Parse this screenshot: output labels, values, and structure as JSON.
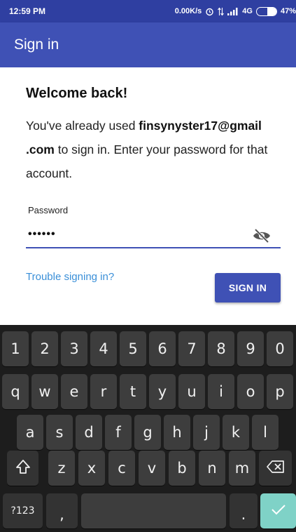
{
  "status_bar": {
    "time": "12:59 PM",
    "network_speed": "0.00K/s",
    "network_type": "4G",
    "battery_percent": "47%",
    "battery_level": 0.47
  },
  "app_bar": {
    "title": "Sign in"
  },
  "content": {
    "title": "Welcome back!",
    "message_prefix": "You've already used ",
    "email_part1": "finsynyster17@gmail",
    "email_part2": ".com",
    "message_suffix": " to sign in. Enter your password for that account.",
    "password_label": "Password",
    "password_value": "••••••",
    "trouble_link": "Trouble signing in?",
    "signin_button": "SIGN IN"
  },
  "keyboard": {
    "row1": [
      "1",
      "2",
      "3",
      "4",
      "5",
      "6",
      "7",
      "8",
      "9",
      "0"
    ],
    "row2": [
      "q",
      "w",
      "e",
      "r",
      "t",
      "y",
      "u",
      "i",
      "o",
      "p"
    ],
    "row3": [
      "a",
      "s",
      "d",
      "f",
      "g",
      "h",
      "j",
      "k",
      "l"
    ],
    "row4": [
      "z",
      "x",
      "c",
      "v",
      "b",
      "n",
      "m"
    ],
    "symbols_key": "?123",
    "comma_key": ",",
    "period_key": ".",
    "shift_icon": "shift-icon",
    "backspace_icon": "backspace-icon",
    "enter_icon": "checkmark-icon"
  },
  "colors": {
    "primary": "#3f51b5",
    "status_bar": "#2f3fa1",
    "link": "#3a8fd8",
    "keyboard_bg": "#1d1d1d",
    "key_bg": "#3d3d3d",
    "enter_key": "#7fd2c7"
  }
}
